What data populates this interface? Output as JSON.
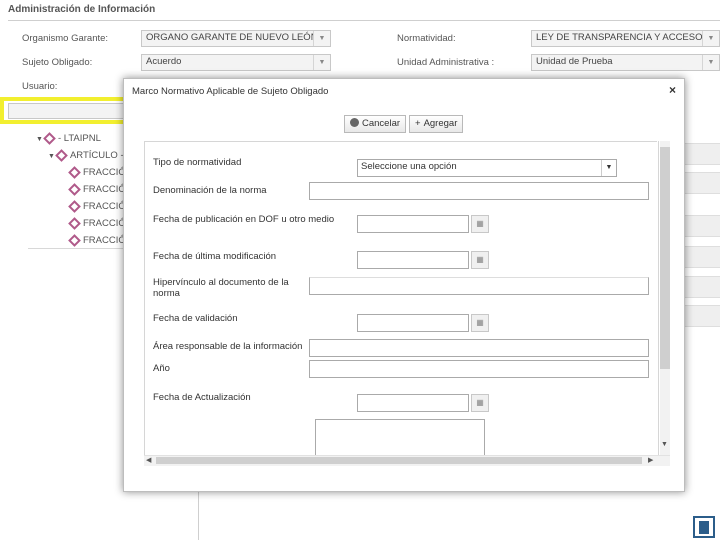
{
  "background": {
    "section_title": "Administración de Información",
    "organismo_label": "Organismo Garante:",
    "organismo_value": "ORGANO GARANTE DE NUEVO LEÓN",
    "normatividad_label": "Normatividad:",
    "normatividad_value": "LEY DE TRANSPARENCIA Y ACCESO A LA I",
    "sujeto_label": "Sujeto Obligado:",
    "sujeto_value": "Acuerdo",
    "unidad_label": "Unidad Administrativa :",
    "unidad_value": "Unidad de Prueba",
    "usuario_label": "Usuario:",
    "tree": [
      {
        "label": "- LTAIPNL",
        "indent": 0
      },
      {
        "label": "ARTÍCULO - C",
        "indent": 1
      },
      {
        "label": "FRACCIÓN",
        "indent": 2
      },
      {
        "label": "FRACCIÓN",
        "indent": 2
      },
      {
        "label": "FRACCIÓN",
        "indent": 2
      },
      {
        "label": "FRACCIÓN",
        "indent": 2
      },
      {
        "label": "FRACCIÓN",
        "indent": 2
      }
    ],
    "highlight_color": "#f2ef2f"
  },
  "modal": {
    "title": "Marco Normativo Aplicable de Sujeto Obligado",
    "close_label": "×",
    "cancel_label": "Cancelar",
    "add_label": "Agregar",
    "fields": {
      "tipo_label": "Tipo de normatividad",
      "tipo_value": "Seleccione una opción",
      "denominacion_label": "Denominación de la norma",
      "fecha_pub_label": "Fecha de publicación en DOF u otro medio",
      "fecha_mod_label": "Fecha de última modificación",
      "hipervinculo_label": "Hipervínculo al documento de la norma",
      "fecha_val_label": "Fecha de validación",
      "area_label": "Área responsable de la información",
      "anio_label": "Año",
      "fecha_act_label": "Fecha de Actualización"
    }
  }
}
